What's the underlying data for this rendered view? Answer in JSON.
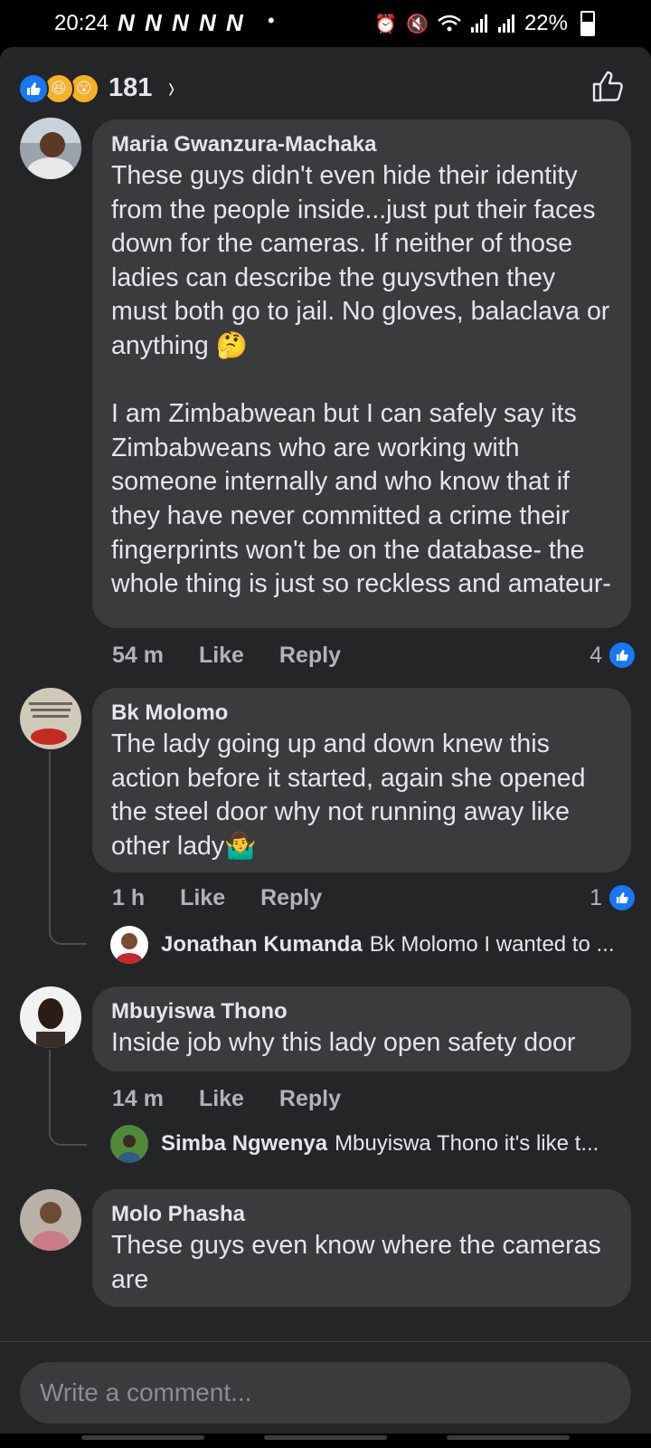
{
  "status": {
    "time": "20:24",
    "notifications": "N N N N N",
    "dot": "•",
    "battery": "22%"
  },
  "header": {
    "reaction_count": "181",
    "chevron": "›"
  },
  "comments": [
    {
      "author": "Maria Gwanzura-Machaka",
      "text": "These guys didn't even hide their identity from the people inside...just put their faces down for the cameras. If neither of those ladies can describe the guysvthen they must both go to jail. No gloves, balaclava or anything 🤔\n\nI am Zimbabwean but I can safely say its Zimbabweans who are working with someone internally and who know that if they have never committed a crime their fingerprints won't be on the database- the whole thing is just so reckless and amateur-",
      "time": "54 m",
      "like": "Like",
      "reply": "Reply",
      "likes": "4"
    },
    {
      "author": "Bk Molomo",
      "text": "The lady going up and down knew this action before it started, again she opened the steel door why not running away like other lady🤷‍♂️",
      "time": "1 h",
      "like": "Like",
      "reply": "Reply",
      "likes": "1",
      "reply_preview": {
        "author": "Jonathan Kumanda",
        "text": "Bk Molomo I wanted to ..."
      }
    },
    {
      "author": "Mbuyiswa Thono",
      "text": "Inside job why this lady open safety door",
      "time": "14 m",
      "like": "Like",
      "reply": "Reply",
      "reply_preview": {
        "author": "Simba Ngwenya",
        "text": "Mbuyiswa Thono it's like t..."
      }
    },
    {
      "author": "Molo Phasha",
      "text": "These guys even know where the cameras are"
    }
  ],
  "composer": {
    "placeholder": "Write a comment..."
  },
  "colors": {
    "accent": "#1877f2",
    "bubble": "#3a3b3c",
    "background": "#242526"
  },
  "icons": [
    "alarm-icon",
    "mute-icon",
    "wifi-icon",
    "signal-icon",
    "battery-icon",
    "like-reaction-icon",
    "haha-reaction-icon",
    "wow-reaction-icon",
    "chevron-right-icon",
    "thumbs-up-outline-icon"
  ]
}
